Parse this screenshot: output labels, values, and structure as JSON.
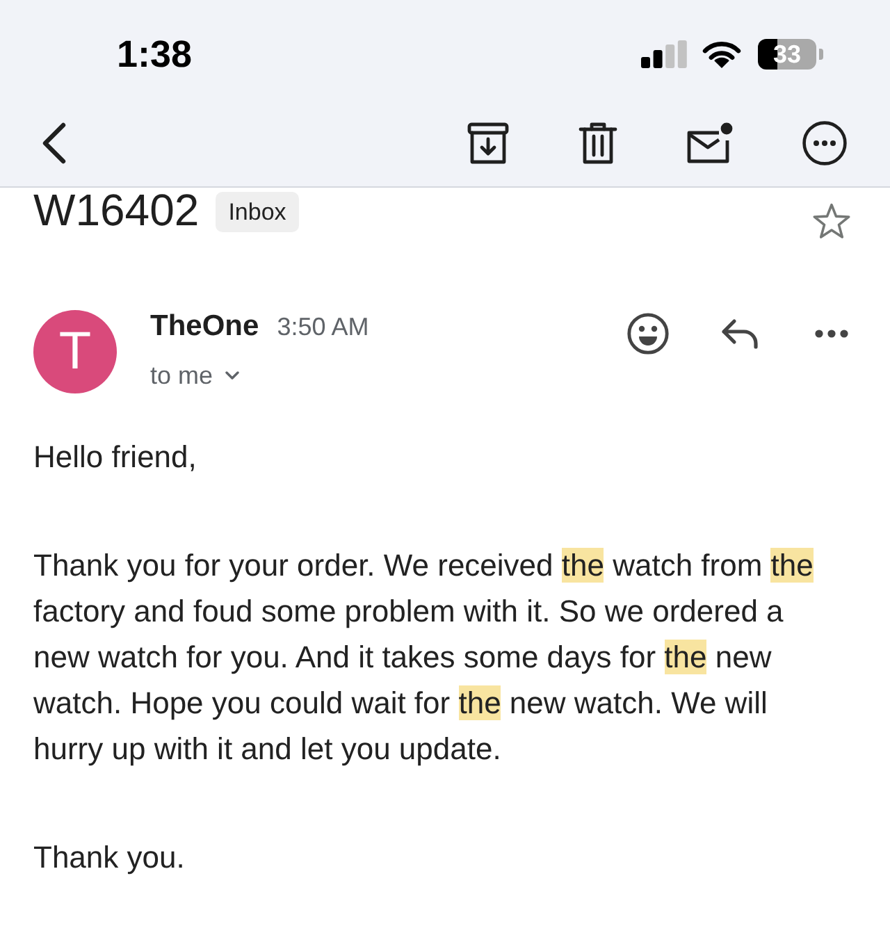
{
  "status_bar": {
    "time": "1:38",
    "battery": "33"
  },
  "message": {
    "subject": "W16402",
    "label": "Inbox",
    "starred": false,
    "sender": {
      "name": "TheOne",
      "initial": "T"
    },
    "time": "3:50 AM",
    "recipient": "to me",
    "body": [
      {
        "segments": [
          {
            "text": "Hello friend,",
            "highlighted": false
          }
        ]
      },
      {
        "segments": [
          {
            "text": "Thank you for your order. We received ",
            "highlighted": false
          },
          {
            "text": "the",
            "highlighted": true
          },
          {
            "text": " watch from ",
            "highlighted": false
          },
          {
            "text": "the",
            "highlighted": true
          },
          {
            "text": " factory and foud some problem with it. So we ordered a new watch for you. And it takes some days for ",
            "highlighted": false
          },
          {
            "text": "the",
            "highlighted": true
          },
          {
            "text": " new watch. Hope you could wait for ",
            "highlighted": false
          },
          {
            "text": "the",
            "highlighted": true
          },
          {
            "text": " new watch. We will hurry up with it and let you update.",
            "highlighted": false
          }
        ]
      },
      {
        "segments": [
          {
            "text": "Thank you.",
            "highlighted": false
          }
        ]
      }
    ]
  }
}
